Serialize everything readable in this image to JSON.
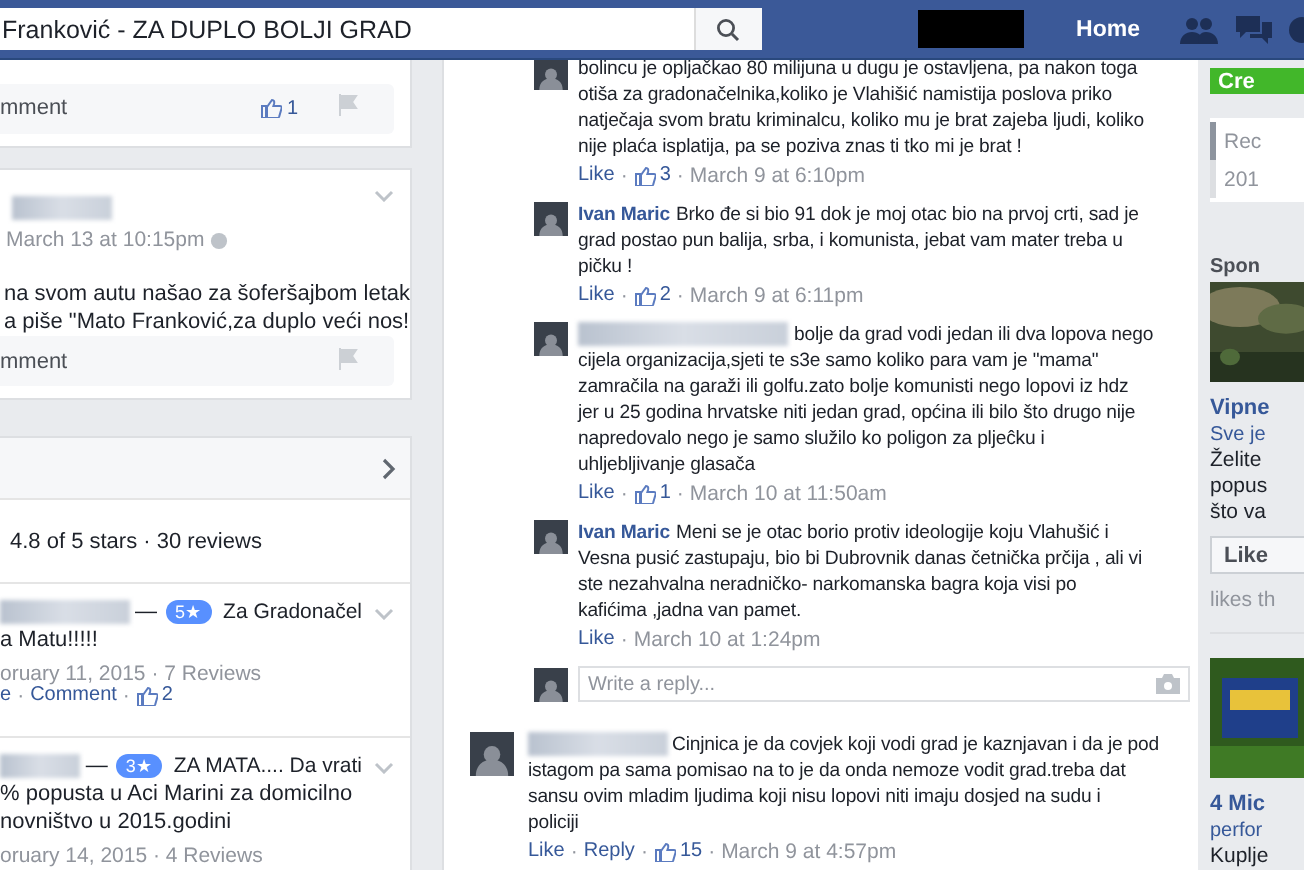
{
  "topbar": {
    "search_value": "Franković - ZA DUPLO BOLJI GRAD",
    "nav": "Home"
  },
  "separator": "·",
  "left_posts": [
    {
      "kind": "footer",
      "action": "mment",
      "likes": "1"
    },
    {
      "kind": "post",
      "time": "March 13 at 10:15pm",
      "lines": [
        "na svom autu našao za šoferšajbom letak",
        "a piše \"Mato Franković,za duplo veći nos!"
      ],
      "action": "mment"
    }
  ],
  "reviews": {
    "summary": "4.8 of 5 stars · 30 reviews",
    "items": [
      {
        "dash": "—",
        "rating": "5★",
        "title": "Za Gradonačel",
        "lines": [
          "a Matu!!!!!"
        ],
        "meta": "oruary 11, 2015 · 7 Reviews",
        "actions": [
          "e",
          "Comment"
        ],
        "likes": "2"
      },
      {
        "dash": "—",
        "rating": "3★",
        "title": "ZA MATA.... Da vrati",
        "lines": [
          "% popusta u Aci Marini za domicilno",
          "novništvo u 2015.godini"
        ],
        "meta": "oruary 14, 2015 · 4 Reviews"
      }
    ]
  },
  "replies": [
    {
      "kind": "continued",
      "lines": [
        "bolincu je opljačkao 80 milijuna u dugu je ostavljena, pa nakon toga",
        "otiša za gradonačelnika,koliko je Vlahišić namistija poslova priko",
        "natječaja svom bratu kriminalcu, koliko mu je brat zajeba ljudi, koliko",
        "nije plaća isplatija, pa se poziva znas ti tko mi je brat !"
      ],
      "actions": [
        "Like"
      ],
      "likes": "3",
      "time": "March 9 at 6:10pm"
    },
    {
      "kind": "named",
      "author": "Ivan Maric",
      "lines": [
        "Brko đe si bio 91 dok je moj otac bio na prvoj crti, sad je",
        "grad postao pun balija, srba, i komunista, jebat vam mater treba u",
        "pičku !"
      ],
      "actions": [
        "Like"
      ],
      "likes": "2",
      "time": "March 9 at 6:11pm"
    },
    {
      "kind": "anonymous",
      "lines": [
        "bolje da grad vodi jedan ili dva lopova nego",
        "cijela organizacija,sjeti te s3e samo koliko para vam je \"mama\"",
        "zamračila na garaži ili golfu.zato bolje komunisti nego lopovi iz hdz",
        "jer u 25 godina hrvatske niti jedan grad, općina ili bilo što drugo nije",
        "napredovalo nego je samo služilo ko poligon za pljeĉku i",
        "uhljebljivanje glasača"
      ],
      "actions": [
        "Like"
      ],
      "likes": "1",
      "time": "March 10 at 11:50am"
    },
    {
      "kind": "named",
      "author": "Ivan Maric",
      "lines": [
        "Meni se je otac borio protiv ideologije koju Vlahušić i",
        "Vesna pusić zastupaju, bio bi Dubrovnik danas četnička prčija , ali vi",
        "ste nezahvalna neradničko- narkomanska bagra koja visi po",
        "kafićima ,jadna van pamet."
      ],
      "actions": [
        "Like"
      ],
      "time": "March 10 at 1:24pm"
    }
  ],
  "reply_field": {
    "placeholder": "Write a reply..."
  },
  "comment": {
    "lines": [
      "Cinjnica je da covjek koji vodi grad je kaznjavan i da je pod",
      "istagom pa sama pomisao na to je da onda nemoze vodit grad.treba dat",
      "sansu ovim mladim ljudima koji nisu lopovi niti imaju dosjed na sudu i",
      "policiji"
    ],
    "actions": [
      "Like",
      "Reply"
    ],
    "likes": "15",
    "time": "March 9 at 4:57pm"
  },
  "sidebar": {
    "create": "Cre",
    "recent": [
      "Rec",
      "201"
    ],
    "sponsored": "Spon",
    "ads": [
      {
        "title": "Vipne",
        "subtitle": "Sve je",
        "lines": [
          "Želite",
          "popus",
          "što va"
        ],
        "button": "Like",
        "note": "likes th"
      },
      {
        "title": "4 Mic",
        "subtitle": "perfor",
        "lines": [
          "Kuplje"
        ]
      }
    ]
  }
}
